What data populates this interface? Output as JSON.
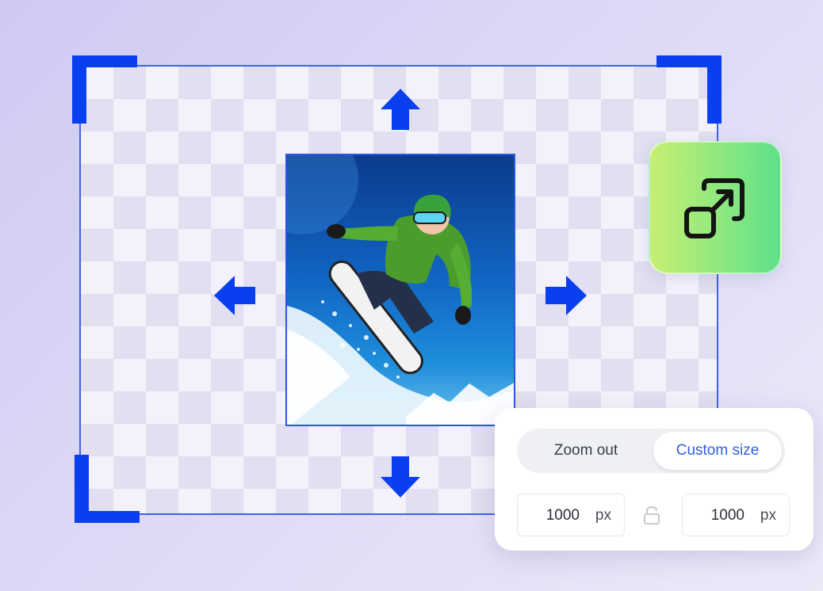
{
  "canvas": {
    "accent_color": "#0a3ff0",
    "handles": [
      "arrow-up-icon",
      "arrow-down-icon",
      "arrow-left-icon",
      "arrow-right-icon"
    ]
  },
  "photo": {
    "subject": "snowboarder-image"
  },
  "resize_button": {
    "icon": "resize-expand-icon",
    "gradient": [
      "#c8ef72",
      "#5fe08c"
    ]
  },
  "size_panel": {
    "tabs": [
      {
        "label": "Zoom out",
        "active": false
      },
      {
        "label": "Custom size",
        "active": true
      }
    ],
    "width": {
      "value": "1000",
      "unit": "px"
    },
    "height": {
      "value": "1000",
      "unit": "px"
    },
    "lock_icon": "lock-icon",
    "active_color": "#2f5ce6"
  }
}
